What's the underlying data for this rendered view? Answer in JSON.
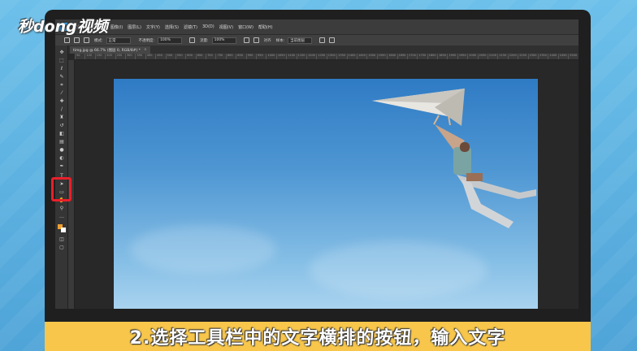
{
  "watermark": {
    "logo_text": "秒dong视频"
  },
  "caption": {
    "text": "2.选择工具栏中的文字横排的按钮，输入文字"
  },
  "menubar": {
    "items": [
      "文件(F)",
      "编辑(E)",
      "图像(I)",
      "图层(L)",
      "文字(Y)",
      "选择(S)",
      "滤镜(T)",
      "3D(D)",
      "视图(V)",
      "窗口(W)",
      "帮助(H)"
    ]
  },
  "options_bar": {
    "mode_label": "模式:",
    "mode_value": "正常",
    "opacity_label": "不透明度:",
    "opacity_value": "100%",
    "flow_label": "流量:",
    "flow_value": "100%",
    "sample_label": "对齐",
    "sample_value": "样本:",
    "sample_select": "当前图层"
  },
  "document_tab": {
    "title": "timg.jpg @ 66.7% (图层 0, RGB/8#) *",
    "close": "×"
  },
  "ruler_ticks": [
    "50",
    "100",
    "150",
    "200",
    "250",
    "300",
    "350",
    "400",
    "450",
    "500",
    "550",
    "600",
    "650",
    "700",
    "750",
    "800",
    "850",
    "900",
    "950",
    "1000",
    "1050",
    "1100",
    "1150",
    "1200",
    "1250",
    "1300",
    "1350",
    "1400",
    "1450",
    "1500",
    "1550",
    "1600",
    "1650",
    "1700",
    "1750",
    "1800",
    "1850",
    "1900",
    "1950",
    "2000",
    "2050",
    "2100",
    "2150",
    "2200",
    "2250",
    "2300",
    "2350",
    "2400",
    "2450",
    "2500"
  ],
  "colors": {
    "accent_red": "#e8202a",
    "caption_bg": "#f7c64b",
    "sky_top": "#2f7bc4"
  }
}
